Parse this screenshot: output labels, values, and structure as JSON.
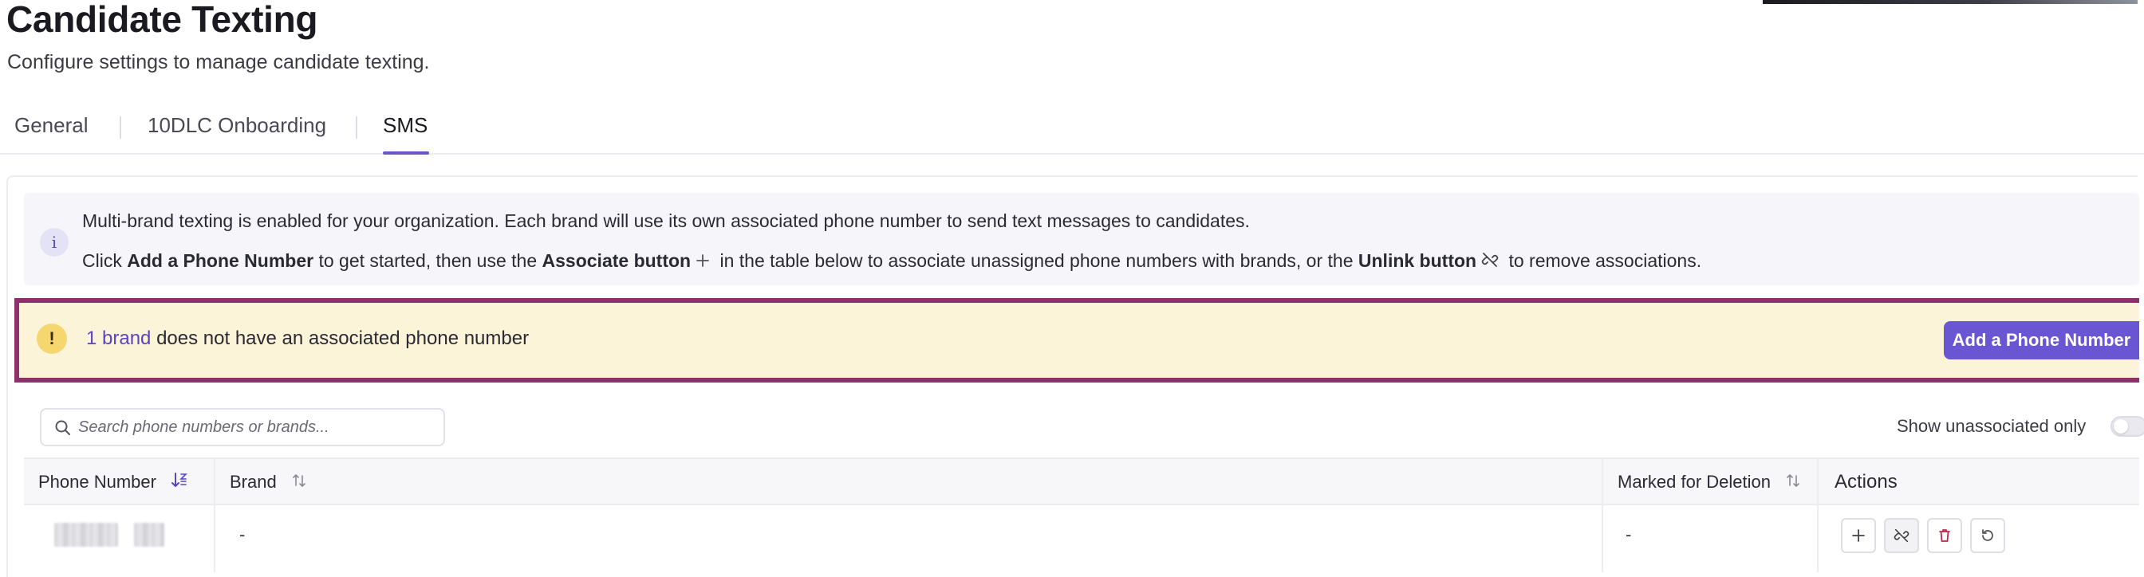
{
  "page": {
    "title": "Candidate Texting",
    "subtitle": "Configure settings to manage candidate texting."
  },
  "tabs": [
    {
      "label": "General",
      "active": false
    },
    {
      "label": "10DLC Onboarding",
      "active": false
    },
    {
      "label": "SMS",
      "active": true
    }
  ],
  "info": {
    "icon": "info-icon",
    "line1": "Multi-brand texting is enabled for your organization. Each brand will use its own associated phone number to send text messages to candidates.",
    "line2_part1": "Click ",
    "line2_bold1": "Add a Phone Number",
    "line2_part2": " to get started, then use the ",
    "line2_bold2": "Associate button",
    "line2_part3": " in the table below to associate unassigned phone numbers with brands, or the ",
    "line2_bold3": "Unlink button",
    "line2_part4": " to remove associations."
  },
  "warning": {
    "icon": "warning-icon",
    "link_text": "1 brand",
    "text": " does not have an associated phone number",
    "button_label": "Add a Phone Number"
  },
  "search": {
    "placeholder": "Search phone numbers or brands...",
    "value": ""
  },
  "filter": {
    "toggle_label": "Show unassociated only",
    "toggle_on": false
  },
  "table": {
    "columns": [
      "Phone Number",
      "Brand",
      "Marked for Deletion",
      "Actions"
    ],
    "rows": [
      {
        "phone_number": "",
        "brand": "-",
        "marked_for_deletion": "-"
      }
    ],
    "row_actions": [
      "associate-button",
      "unlink-button",
      "delete-button",
      "restore-button"
    ]
  },
  "colors": {
    "accent": "#6a56d2",
    "warning_bg": "#fcf4d8",
    "highlight_border": "#8f2f6c",
    "delete": "#c0274a"
  }
}
